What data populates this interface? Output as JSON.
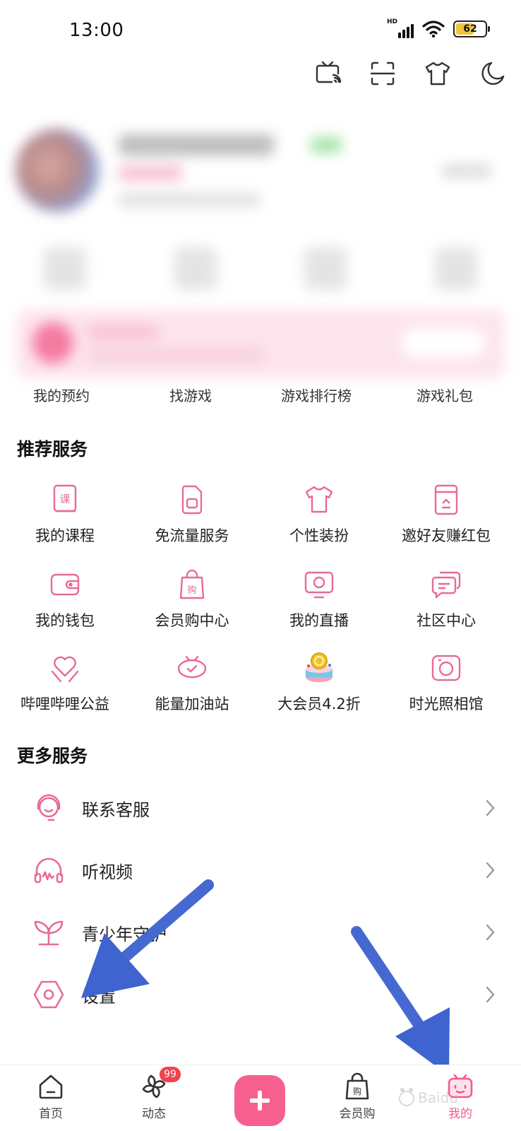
{
  "status_bar": {
    "time": "13:00",
    "network": "HD",
    "battery": "62"
  },
  "top_icons": [
    "tv-cast-icon",
    "scan-icon",
    "tshirt-icon",
    "moon-icon"
  ],
  "game_row": [
    "我的预约",
    "找游戏",
    "游戏排行榜",
    "游戏礼包"
  ],
  "recommended": {
    "title": "推荐服务",
    "items": [
      {
        "label": "我的课程",
        "icon": "course-book-icon"
      },
      {
        "label": "免流量服务",
        "icon": "sim-card-icon"
      },
      {
        "label": "个性装扮",
        "icon": "tshirt-icon"
      },
      {
        "label": "邀好友赚红包",
        "icon": "red-envelope-icon"
      },
      {
        "label": "我的钱包",
        "icon": "wallet-icon"
      },
      {
        "label": "会员购中心",
        "icon": "shopping-bag-icon"
      },
      {
        "label": "我的直播",
        "icon": "live-tv-icon"
      },
      {
        "label": "社区中心",
        "icon": "chat-bubbles-icon"
      },
      {
        "label": "哔哩哔哩公益",
        "icon": "heart-hands-icon"
      },
      {
        "label": "能量加油站",
        "icon": "energy-tv-icon"
      },
      {
        "label": "大会员4.2折",
        "icon": "cake-coin-icon"
      },
      {
        "label": "时光照相馆",
        "icon": "camera-icon"
      }
    ]
  },
  "more": {
    "title": "更多服务",
    "items": [
      {
        "label": "联系客服",
        "icon": "headset-icon"
      },
      {
        "label": "听视频",
        "icon": "headphones-icon"
      },
      {
        "label": "青少年守护",
        "icon": "sprout-icon"
      },
      {
        "label": "设置",
        "icon": "settings-hexagon-icon"
      }
    ]
  },
  "bottom_nav": {
    "home": "首页",
    "dynamic": "动态",
    "dynamic_badge": "99",
    "shop": "会员购",
    "mine": "我的"
  },
  "colors": {
    "accent": "#f45a8d",
    "arrow": "#3f63cf"
  }
}
